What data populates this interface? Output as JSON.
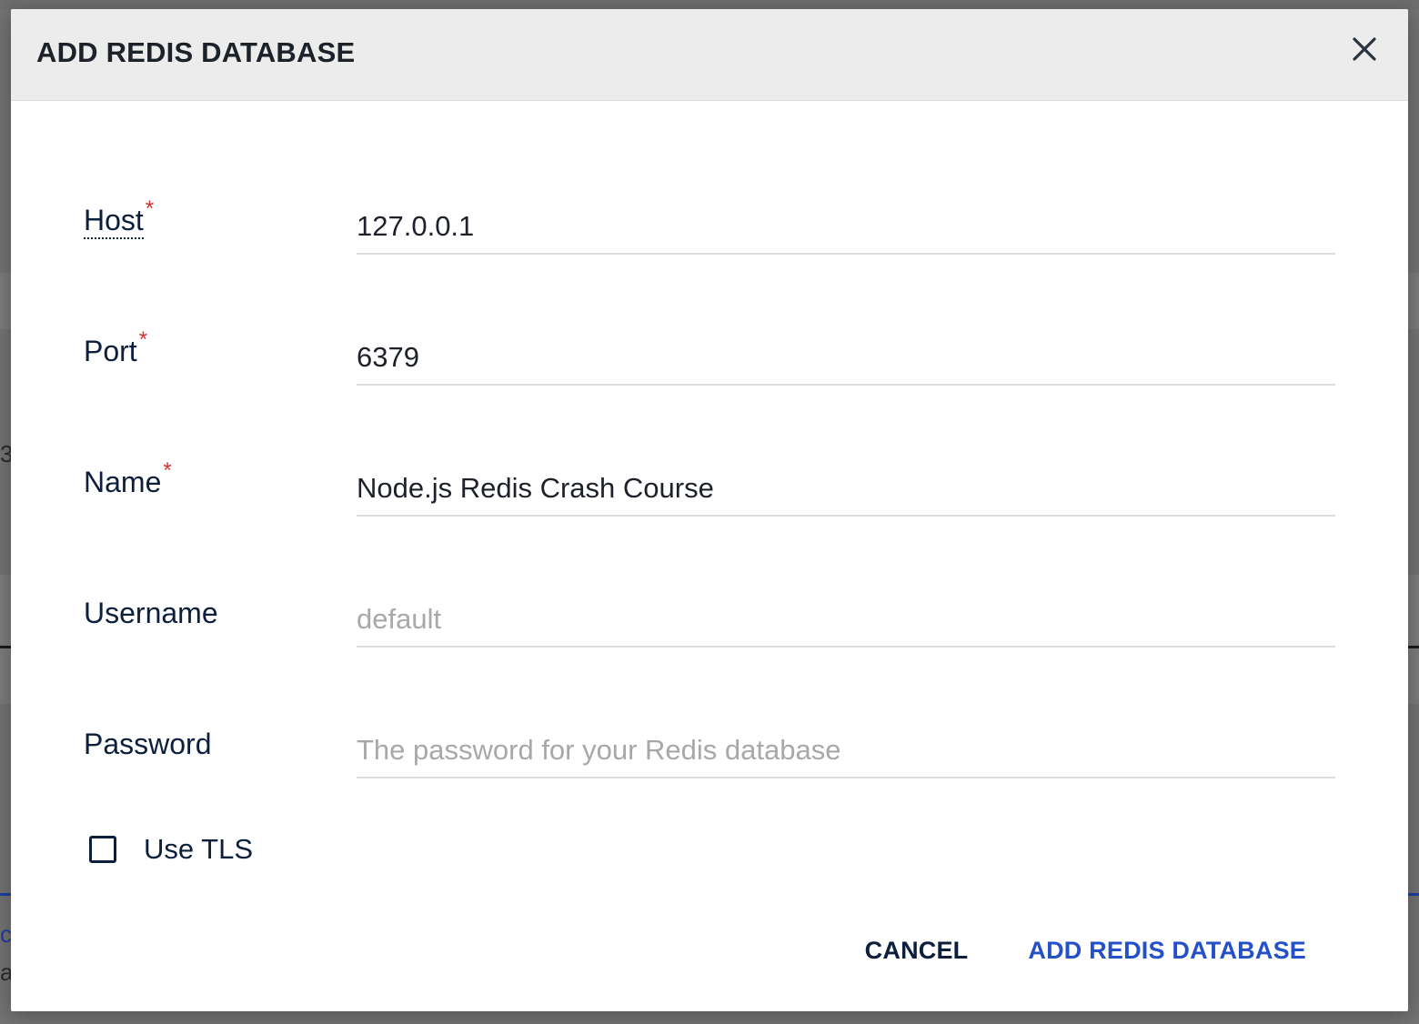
{
  "dialog": {
    "title": "ADD REDIS DATABASE",
    "close_icon": "close-icon"
  },
  "form": {
    "host": {
      "label": "Host",
      "required_mark": "*",
      "value": "127.0.0.1",
      "placeholder": ""
    },
    "port": {
      "label": "Port",
      "required_mark": "*",
      "value": "6379",
      "placeholder": ""
    },
    "name": {
      "label": "Name",
      "required_mark": "*",
      "value": "Node.js Redis Crash Course",
      "placeholder": ""
    },
    "username": {
      "label": "Username",
      "value": "",
      "placeholder": "default"
    },
    "password": {
      "label": "Password",
      "value": "",
      "placeholder": "The password for your Redis database"
    },
    "tls": {
      "label": "Use TLS",
      "checked": false
    }
  },
  "actions": {
    "cancel_label": "CANCEL",
    "submit_label": "ADD REDIS DATABASE"
  },
  "background": {
    "glyph_1": "3",
    "glyph_2": "c",
    "glyph_3": "a"
  },
  "colors": {
    "primary": "#2450c8",
    "required": "#d32f2f",
    "text_dark": "#0c1f3c"
  }
}
